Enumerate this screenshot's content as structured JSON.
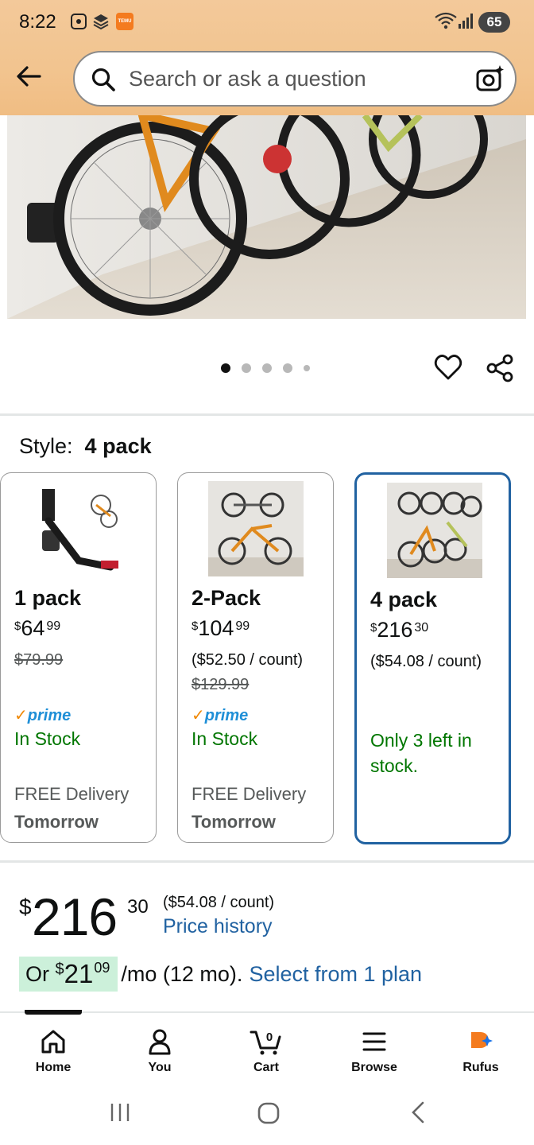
{
  "status": {
    "time": "8:22",
    "battery": "65"
  },
  "search": {
    "placeholder": "Search or ask a question"
  },
  "carousel": {
    "total": 5,
    "active": 0
  },
  "style": {
    "label": "Style:",
    "value": "4 pack"
  },
  "options": [
    {
      "name": "1 pack",
      "price_symbol": "$",
      "price_whole": "64",
      "price_cents": "99",
      "list_price": "$79.99",
      "per_count": "",
      "prime": "prime",
      "stock": "In Stock",
      "delivery": "FREE Delivery",
      "delivery_day": "Tomorrow",
      "selected": false
    },
    {
      "name": "2-Pack",
      "price_symbol": "$",
      "price_whole": "104",
      "price_cents": "99",
      "per_count": "($52.50 / count)",
      "list_price": "$129.99",
      "prime": "prime",
      "stock": "In Stock",
      "delivery": "FREE Delivery",
      "delivery_day": "Tomorrow",
      "selected": false
    },
    {
      "name": "4 pack",
      "price_symbol": "$",
      "price_whole": "216",
      "price_cents": "30",
      "per_count": "($54.08 / count)",
      "list_price": "",
      "prime": "",
      "stock": "Only 3 left in stock.",
      "delivery": "",
      "delivery_day": "",
      "selected": true
    }
  ],
  "price": {
    "symbol": "$",
    "whole": "216",
    "cents": "30",
    "per_count": "($54.08 / count)",
    "history_link": "Price history"
  },
  "installment": {
    "prefix": "Or",
    "symbol": "$",
    "whole": "21",
    "cents": "09",
    "suffix": "/mo (12 mo).",
    "link": "Select from 1 plan"
  },
  "nav": {
    "home": "Home",
    "you": "You",
    "cart": "Cart",
    "cart_count": "0",
    "browse": "Browse",
    "rufus": "Rufus"
  },
  "colors": {
    "accent": "#2162a1",
    "in_stock": "#007600",
    "header": "#f2c48f",
    "emi_highlight": "#ccf0da"
  }
}
